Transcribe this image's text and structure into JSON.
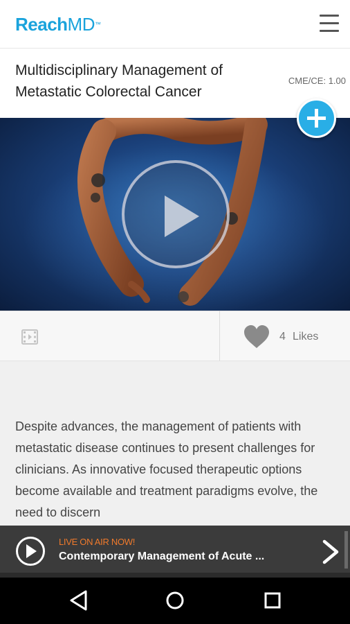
{
  "app": {
    "logo_bold": "Reach",
    "logo_light": "MD",
    "logo_mark": "™"
  },
  "header": {
    "title": "Multidisciplinary Management of Metastatic Colorectal Cancer",
    "cme_label": "CME/CE: 1.00"
  },
  "actions": {
    "likes_count": "4",
    "likes_label": "Likes"
  },
  "description": "Despite advances, the management of patients with metastatic disease continues to present challenges for clinicians. As innovative focused therapeutic options become available and treatment paradigms evolve, the need to discern",
  "live": {
    "label": "LIVE ON AIR NOW!",
    "title": "Contemporary Management of Acute ..."
  },
  "icons": {
    "menu": "hamburger-menu-icon",
    "add": "plus-icon",
    "play": "play-icon",
    "video": "film-icon",
    "like": "heart-icon",
    "next": "chevron-right-icon",
    "nav_back": "back-triangle-icon",
    "nav_home": "home-circle-icon",
    "nav_recents": "recents-square-icon"
  },
  "colors": {
    "brand": "#1aa3dc",
    "add_button": "#29aee6",
    "live_accent": "#f07a2c",
    "live_bar": "#3b3b3b"
  }
}
